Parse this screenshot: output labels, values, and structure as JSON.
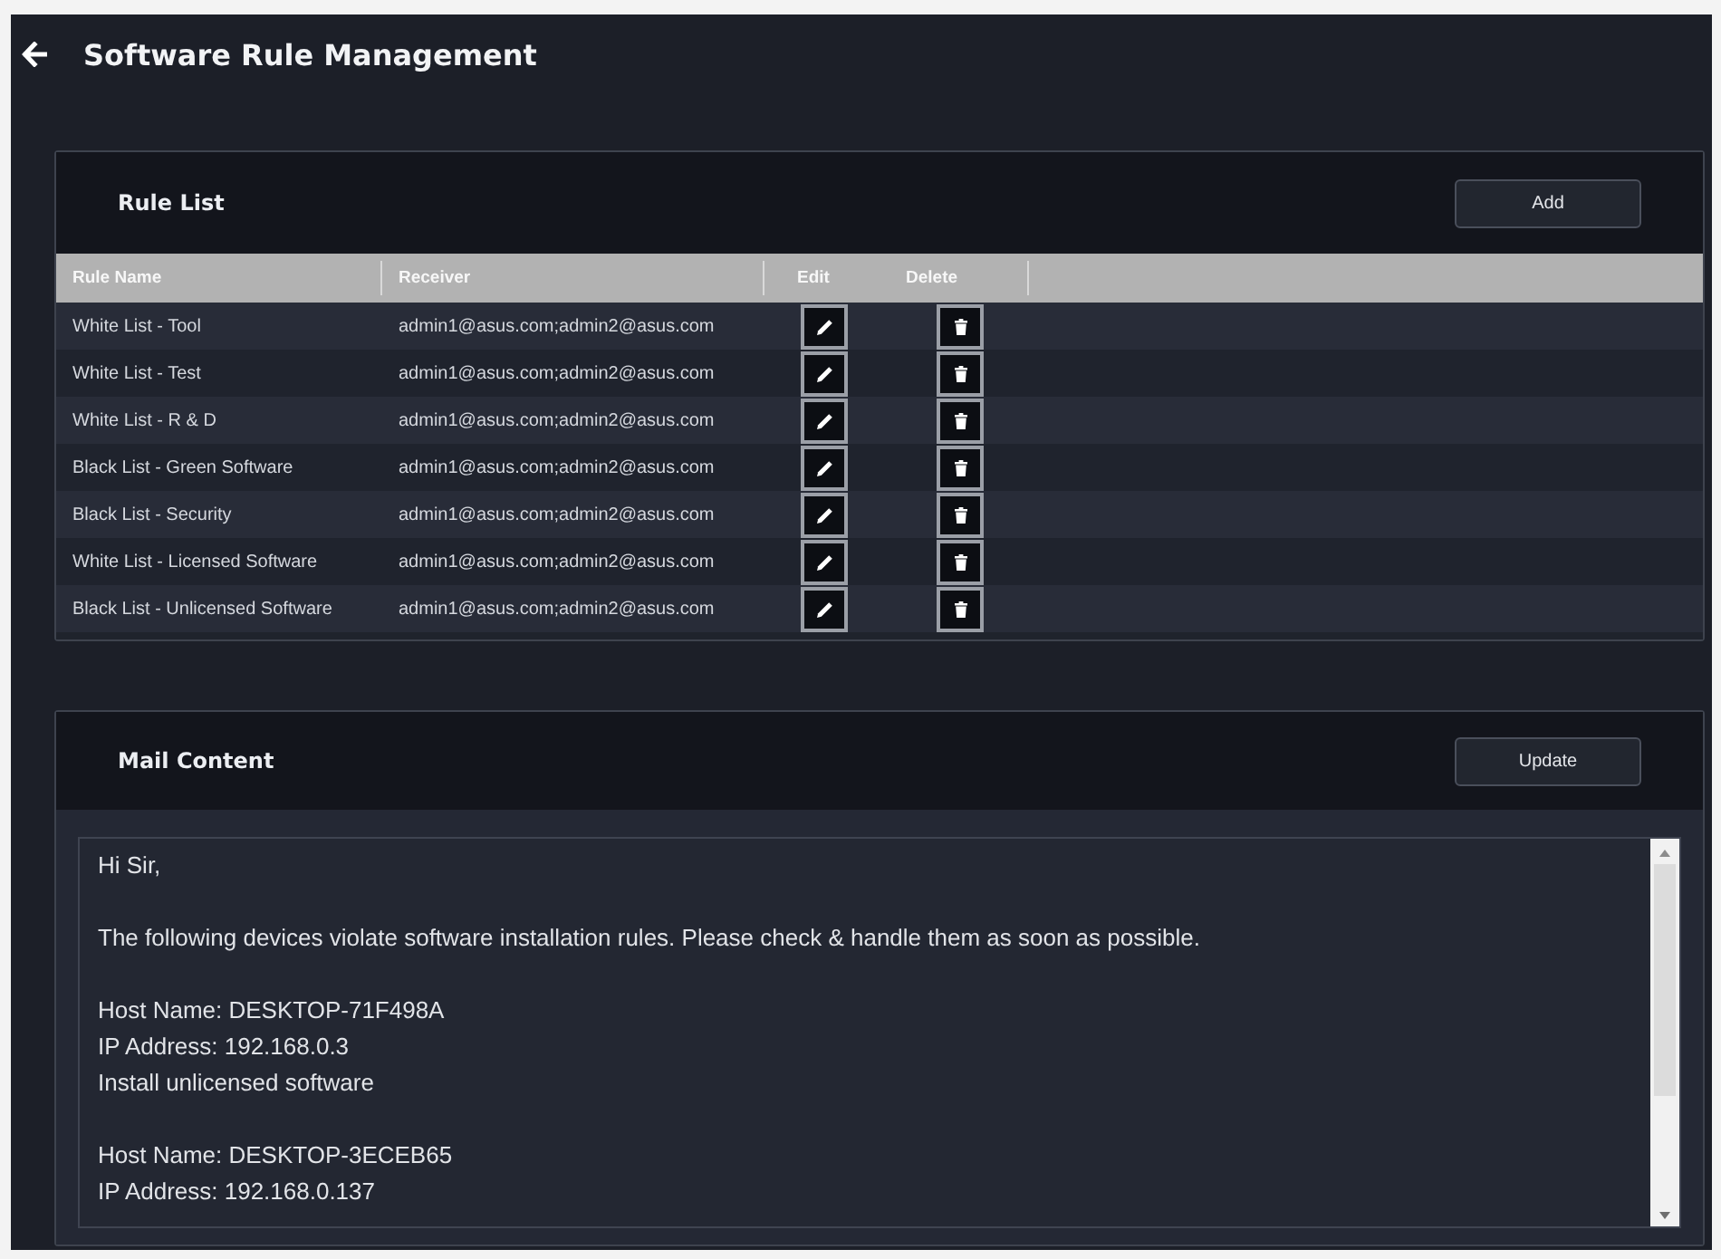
{
  "page": {
    "title": "Software Rule Management"
  },
  "rule_list": {
    "title": "Rule List",
    "add_button": "Add",
    "columns": [
      "Rule Name",
      "Receiver",
      "Edit",
      "Delete"
    ],
    "rows": [
      {
        "rule_name": "White List - Tool",
        "receiver": "admin1@asus.com;admin2@asus.com"
      },
      {
        "rule_name": "White List - Test",
        "receiver": "admin1@asus.com;admin2@asus.com"
      },
      {
        "rule_name": "White List - R & D",
        "receiver": "admin1@asus.com;admin2@asus.com"
      },
      {
        "rule_name": "Black List - Green Software",
        "receiver": "admin1@asus.com;admin2@asus.com"
      },
      {
        "rule_name": "Black List - Security",
        "receiver": "admin1@asus.com;admin2@asus.com"
      },
      {
        "rule_name": "White List - Licensed Software",
        "receiver": "admin1@asus.com;admin2@asus.com"
      },
      {
        "rule_name": "Black List - Unlicensed Software",
        "receiver": "admin1@asus.com;admin2@asus.com"
      }
    ]
  },
  "mail_content": {
    "title": "Mail Content",
    "update_button": "Update",
    "paragraphs": [
      [
        "Hi Sir,"
      ],
      [
        "The following devices violate software installation rules. Please check & handle them as soon as possible."
      ],
      [
        "Host Name: DESKTOP-71F498A",
        "IP Address: 192.168.0.3",
        "Install unlicensed software"
      ],
      [
        "Host Name: DESKTOP-3ECEB65",
        "IP Address: 192.168.0.137"
      ]
    ]
  }
}
